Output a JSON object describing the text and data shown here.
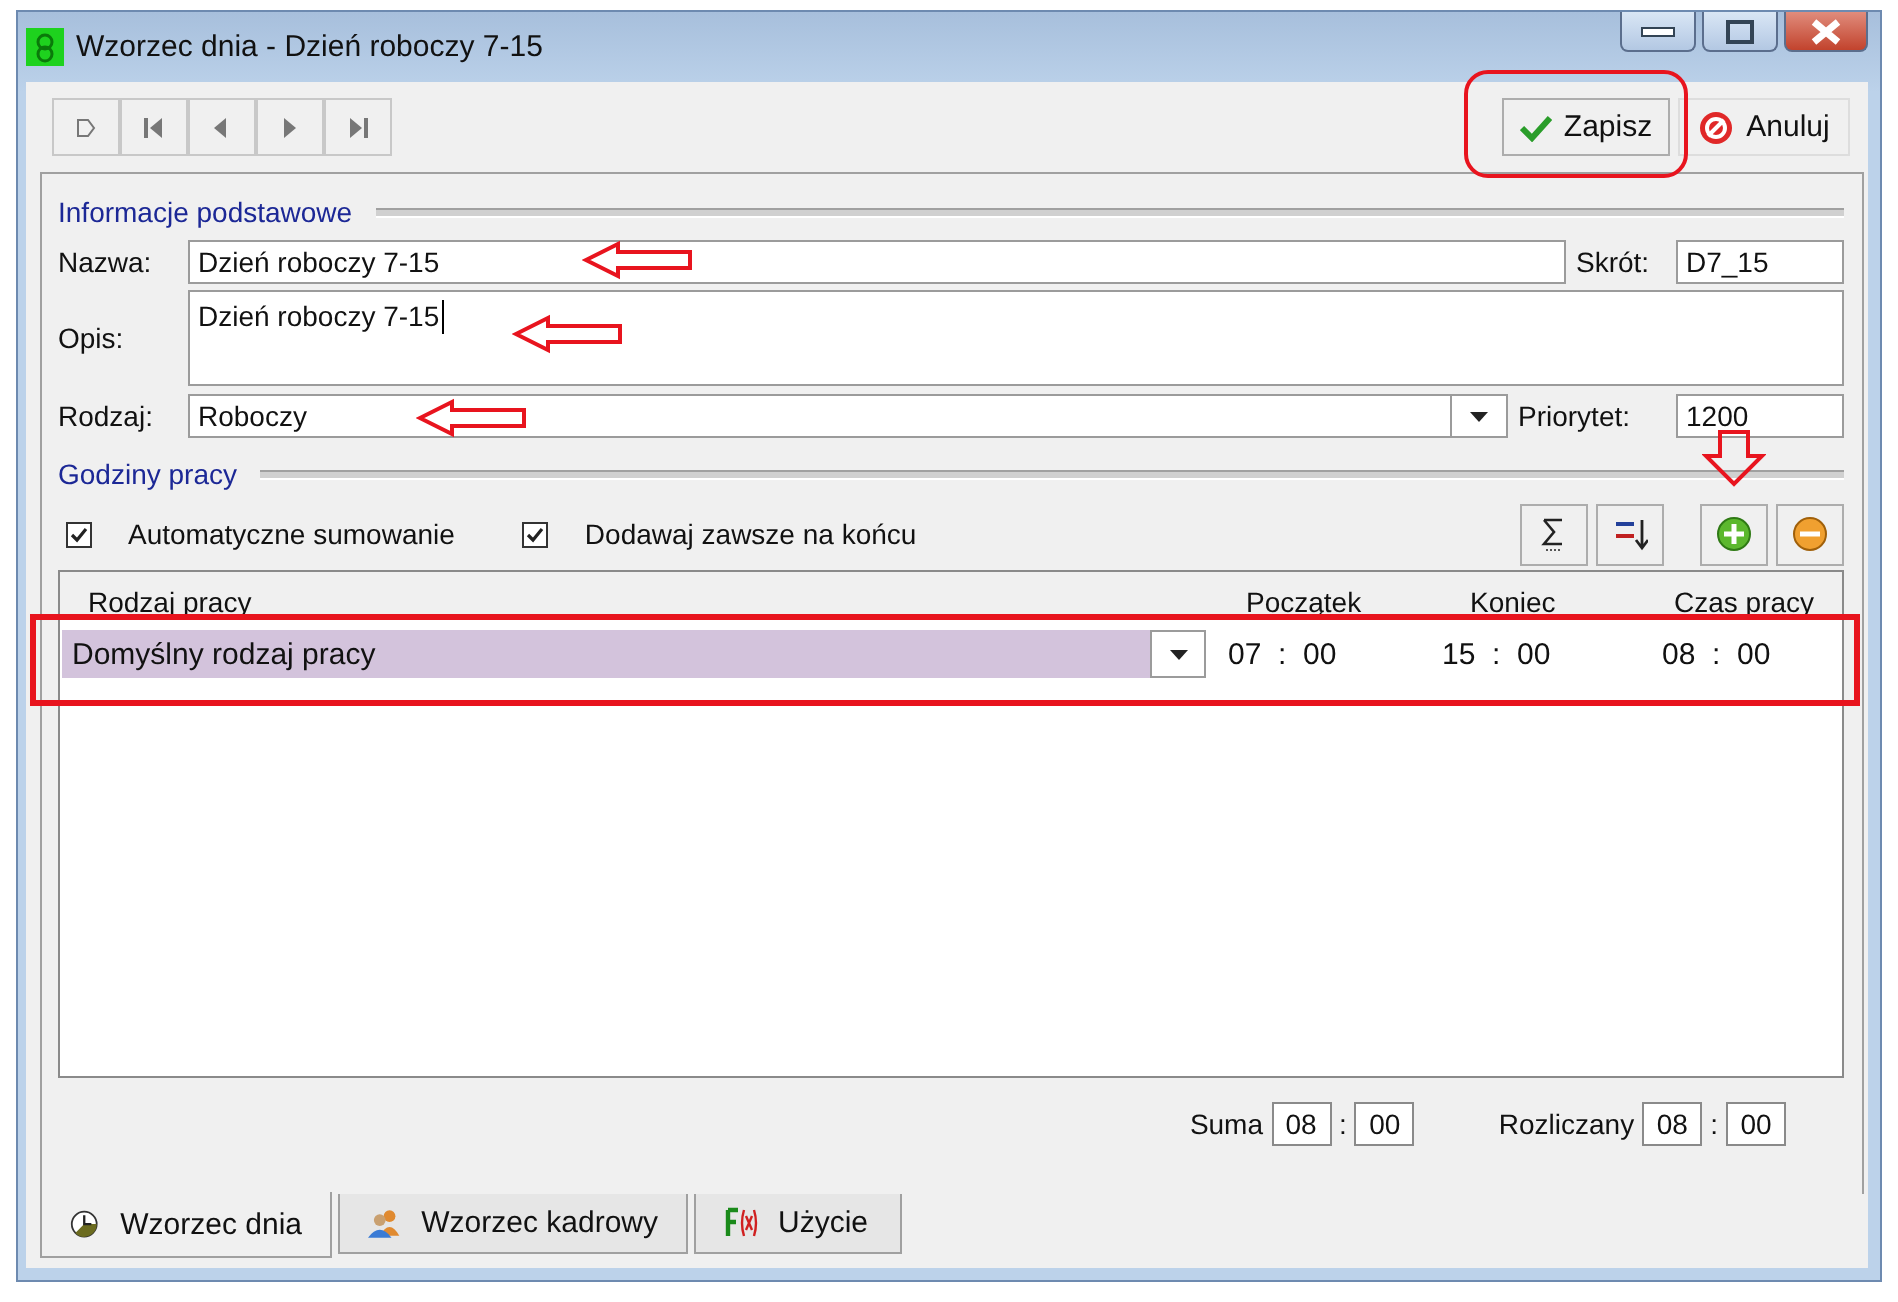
{
  "window": {
    "title": "Wzorzec dnia - Dzień roboczy 7-15"
  },
  "toolbar": {
    "nav_buttons": [
      {
        "kind": "new"
      },
      {
        "kind": "first"
      },
      {
        "kind": "prev"
      },
      {
        "kind": "next"
      },
      {
        "kind": "last"
      }
    ],
    "actions": [
      {
        "label": "Zapisz",
        "kind": "save",
        "marked": true
      },
      {
        "label": "Anuluj",
        "kind": "cancel",
        "marked": false
      }
    ]
  },
  "basic_info": {
    "heading": "Informacje podstawowe",
    "name": {
      "label": "Nazwa:",
      "value": "Dzień roboczy 7-15",
      "marked": true
    },
    "short_name": {
      "label": "Skrót:",
      "value": "D7_15"
    },
    "description": {
      "label": "Opis:",
      "value": "Dzień roboczy 7-15",
      "marked": true
    },
    "type": {
      "label": "Rodzaj:",
      "value": "Roboczy",
      "marked": true
    },
    "priority": {
      "label": "Priorytet:",
      "value": "1200"
    }
  },
  "work_hours": {
    "heading": "Godziny pracy",
    "options": [
      {
        "label": "Automatyczne sumowanie",
        "checked": true
      },
      {
        "label": "Dodawaj zawsze na końcu",
        "checked": true
      }
    ],
    "tools": [
      {
        "kind": "sum",
        "marked": false
      },
      {
        "kind": "sort",
        "marked": false
      },
      {
        "kind": "add",
        "marked": true
      },
      {
        "kind": "remove",
        "marked": false
      }
    ],
    "columns": [
      "Rodzaj pracy",
      "Początek",
      "Koniec",
      "Czas pracy"
    ],
    "rows": [
      {
        "work_type": "Domyślny rodzaj pracy",
        "start": "07  :  00",
        "end": "15  :  00",
        "duration": "08  :  00",
        "selected": true,
        "marked": true
      }
    ],
    "sum": {
      "label": "Suma",
      "hours": "08",
      "separator": ":",
      "minutes": "00"
    },
    "settled": {
      "label": "Rozliczany",
      "hours": "08",
      "separator": ":",
      "minutes": "00"
    }
  },
  "tabs": [
    {
      "label": "Wzorzec dnia",
      "kind": "clock",
      "selected": true
    },
    {
      "label": "Wzorzec kadrowy",
      "kind": "people",
      "selected": false
    },
    {
      "label": "Użycie",
      "kind": "function",
      "selected": false
    }
  ]
}
